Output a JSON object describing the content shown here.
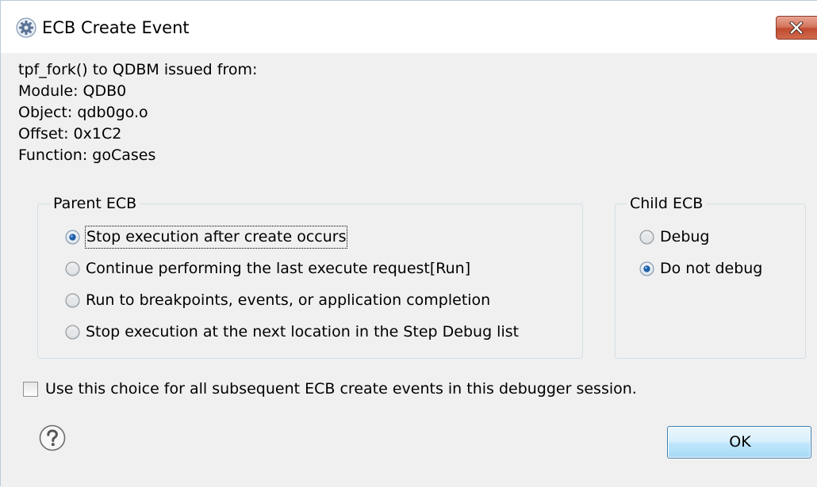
{
  "window": {
    "title": "ECB Create Event",
    "icon": "gear-icon",
    "close_icon": "close-icon"
  },
  "info": {
    "lines": [
      "tpf_fork() to QDBM issued from:",
      "Module: QDB0",
      "Object: qdb0go.o",
      "Offset: 0x1C2",
      "Function: goCases"
    ]
  },
  "parent_ecb": {
    "legend": "Parent ECB",
    "options": [
      {
        "label": "Stop execution after create occurs",
        "selected": true
      },
      {
        "label": "Continue performing the last execute request[Run]",
        "selected": false
      },
      {
        "label": "Run to breakpoints, events, or application completion",
        "selected": false
      },
      {
        "label": "Stop execution at the next location in the Step Debug list",
        "selected": false
      }
    ]
  },
  "child_ecb": {
    "legend": "Child ECB",
    "options": [
      {
        "label": "Debug",
        "selected": false
      },
      {
        "label": "Do not debug",
        "selected": true
      }
    ]
  },
  "remember_choice": {
    "label": "Use this choice for all subsequent ECB create events in this debugger session.",
    "checked": false
  },
  "footer": {
    "help_icon": "help-icon",
    "ok_label": "OK"
  },
  "colors": {
    "dialog_background": "#f0f0f0",
    "title_background": "#ffffff",
    "close_button_red": "#c24b30",
    "ok_button_border": "#3c7fb1",
    "radio_selected_dot": "#1f5fa8"
  }
}
